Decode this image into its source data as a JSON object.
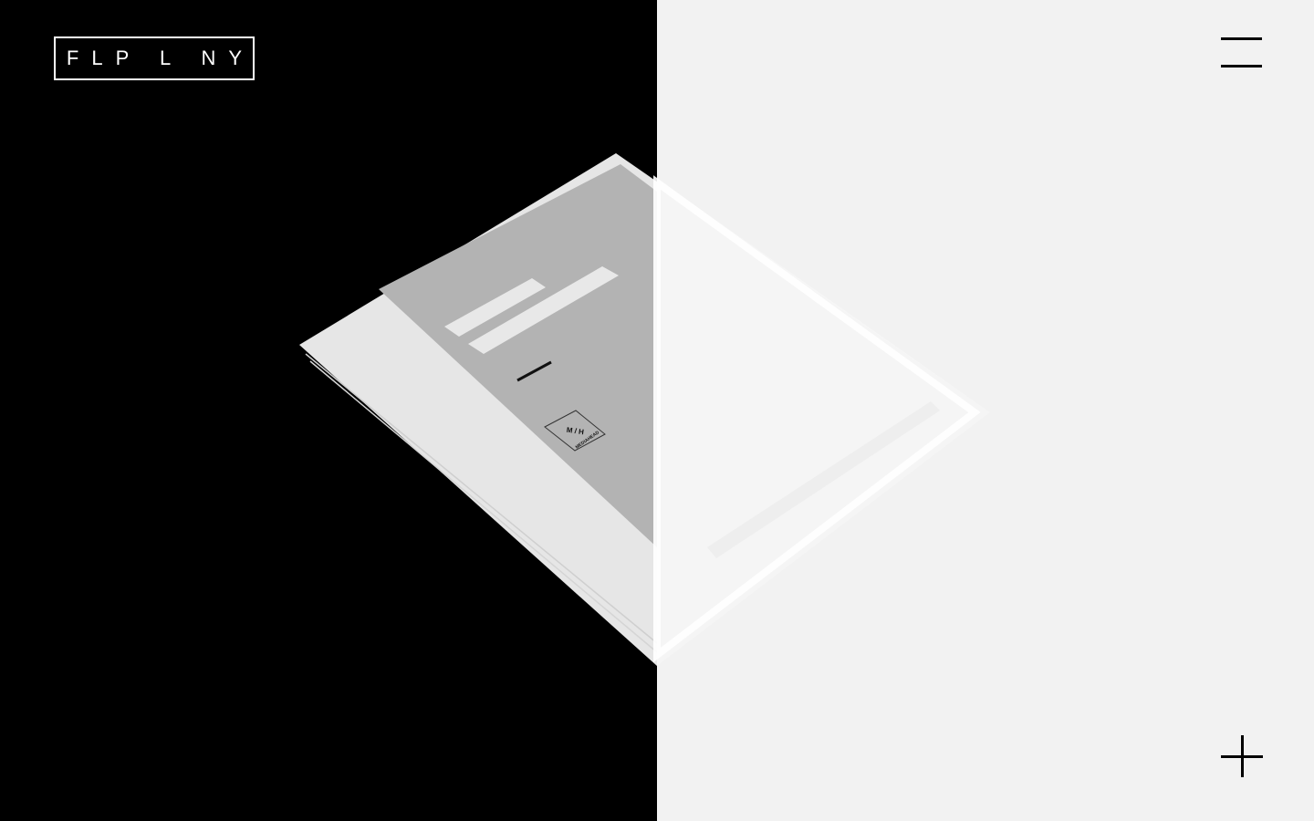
{
  "header": {
    "logo_text": "FLP L NY",
    "menu_icon": "hamburger-menu-icon"
  },
  "hero": {
    "image_logo_lettering": [
      "M / H",
      "MEDIAHEAD"
    ]
  },
  "footer": {
    "plus_icon": "plus-icon"
  },
  "colors": {
    "left_panel": "#000000",
    "right_panel": "#f2f2f2",
    "paper": "#e8e8e8",
    "paper_inner": "#b3b3b3"
  }
}
